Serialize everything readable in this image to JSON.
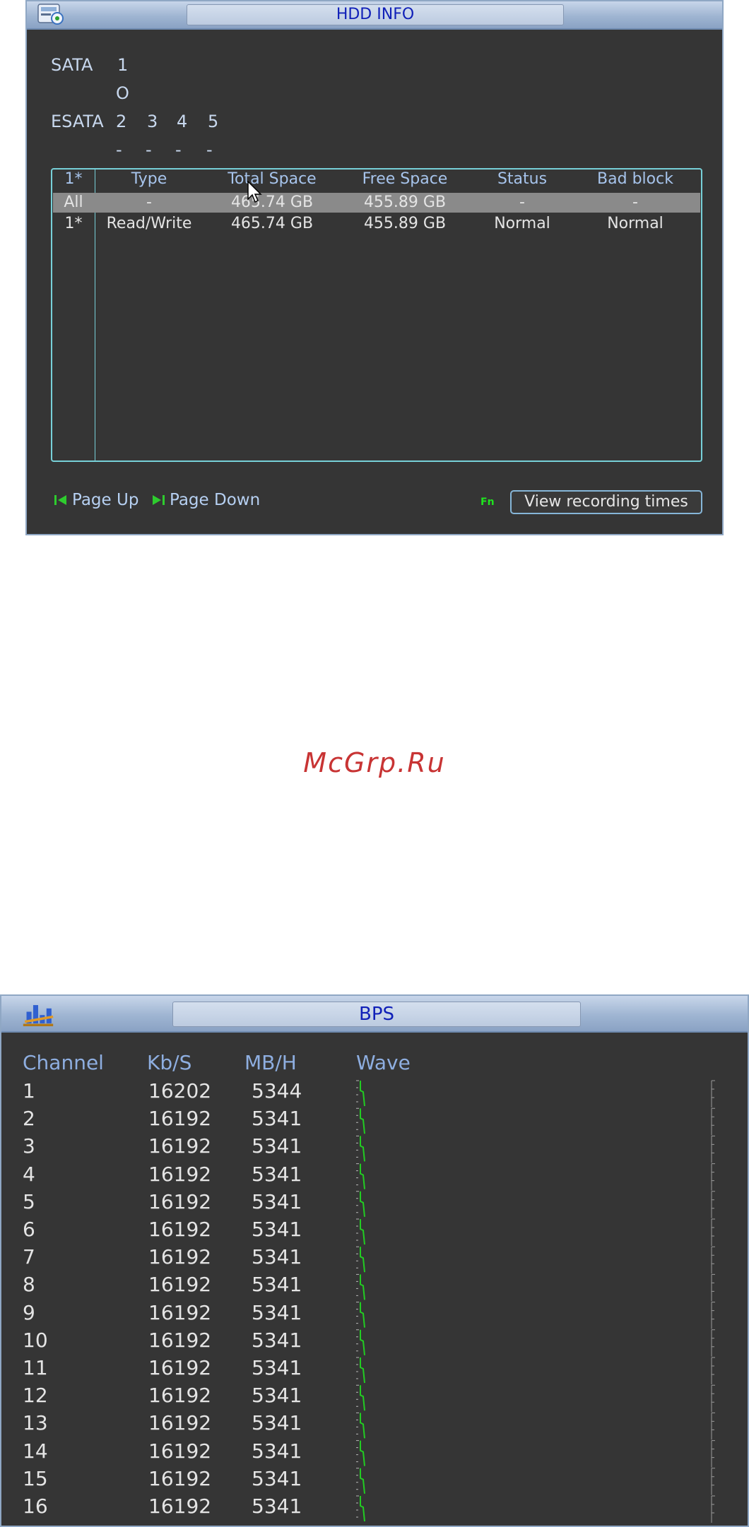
{
  "hdd_window": {
    "title": "HDD INFO",
    "sata_label": "SATA",
    "sata_ports": [
      "1"
    ],
    "sata_status": [
      "O"
    ],
    "esata_label": "ESATA",
    "esata_ports": [
      "2",
      "3",
      "4",
      "5"
    ],
    "esata_status": [
      "-",
      "-",
      "-",
      "-"
    ],
    "table": {
      "headers": [
        "1*",
        "Type",
        "Total Space",
        "Free Space",
        "Status",
        "Bad block"
      ],
      "rows": [
        [
          "All",
          "-",
          "465.74 GB",
          "455.89 GB",
          "-",
          "-"
        ],
        [
          "1*",
          "Read/Write",
          "465.74 GB",
          "455.89 GB",
          "Normal",
          "Normal"
        ]
      ]
    },
    "page_up_label": "Page Up",
    "page_down_label": "Page Down",
    "fn_label": "Fn",
    "view_recording_label": "View recording times"
  },
  "watermark": "McGrp.Ru",
  "bps_window": {
    "title": "BPS",
    "headers": {
      "channel": "Channel",
      "kbs": "Kb/S",
      "mbh": "MB/H",
      "wave": "Wave"
    },
    "rows": [
      {
        "channel": "1",
        "kbs": "16202",
        "mbh": "5344"
      },
      {
        "channel": "2",
        "kbs": "16192",
        "mbh": "5341"
      },
      {
        "channel": "3",
        "kbs": "16192",
        "mbh": "5341"
      },
      {
        "channel": "4",
        "kbs": "16192",
        "mbh": "5341"
      },
      {
        "channel": "5",
        "kbs": "16192",
        "mbh": "5341"
      },
      {
        "channel": "6",
        "kbs": "16192",
        "mbh": "5341"
      },
      {
        "channel": "7",
        "kbs": "16192",
        "mbh": "5341"
      },
      {
        "channel": "8",
        "kbs": "16192",
        "mbh": "5341"
      },
      {
        "channel": "9",
        "kbs": "16192",
        "mbh": "5341"
      },
      {
        "channel": "10",
        "kbs": "16192",
        "mbh": "5341"
      },
      {
        "channel": "11",
        "kbs": "16192",
        "mbh": "5341"
      },
      {
        "channel": "12",
        "kbs": "16192",
        "mbh": "5341"
      },
      {
        "channel": "13",
        "kbs": "16192",
        "mbh": "5341"
      },
      {
        "channel": "14",
        "kbs": "16192",
        "mbh": "5341"
      },
      {
        "channel": "15",
        "kbs": "16192",
        "mbh": "5341"
      },
      {
        "channel": "16",
        "kbs": "16192",
        "mbh": "5341"
      }
    ],
    "wave_color": "#22cc22"
  },
  "colors": {
    "panel_bg": "#353535",
    "title_text": "#1020b8",
    "label_text": "#c8d8ee",
    "header_text": "#8eaee0",
    "table_border": "#77d0d8",
    "fn_green": "#1ee51e",
    "watermark": "#c83434"
  },
  "icons": {
    "hdd_title_icon": "hdd-info-icon",
    "bps_title_icon": "bar-chart-icon",
    "page_up_icon": "skip-back-icon",
    "page_down_icon": "skip-forward-icon",
    "cursor": "mouse-pointer-icon"
  }
}
